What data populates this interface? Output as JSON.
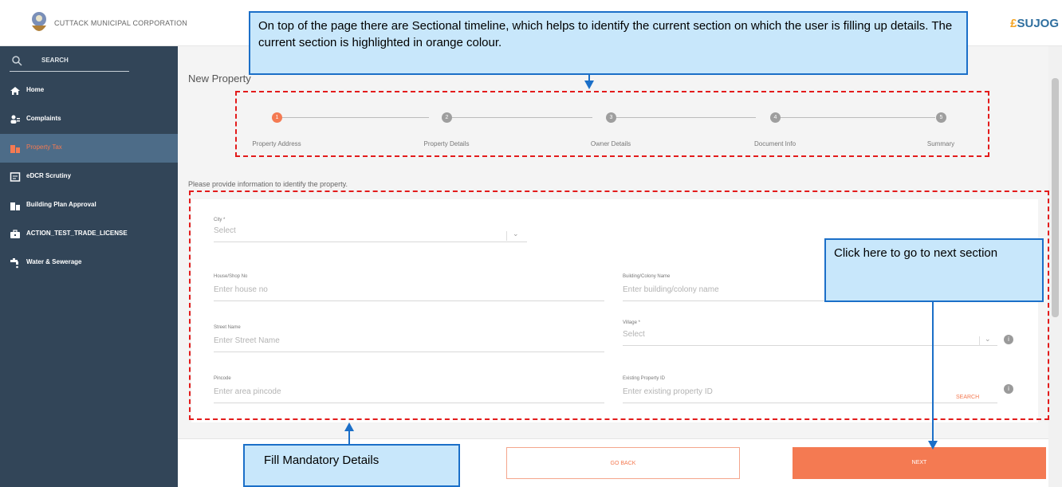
{
  "header": {
    "org_name": "CUTTACK MUNICIPAL CORPORATION",
    "brand_lead": "£",
    "brand_name": "SUJOG"
  },
  "sidebar": {
    "search_label": "SEARCH",
    "items": [
      {
        "label": "Home",
        "icon": "home-icon"
      },
      {
        "label": "Complaints",
        "icon": "people-icon"
      },
      {
        "label": "Property Tax",
        "icon": "building-icon",
        "active": true
      },
      {
        "label": "eDCR Scrutiny",
        "icon": "document-icon"
      },
      {
        "label": "Building Plan Approval",
        "icon": "building-icon"
      },
      {
        "label": "ACTION_TEST_TRADE_LICENSE",
        "icon": "briefcase-icon"
      },
      {
        "label": "Water & Sewerage",
        "icon": "water-tap-icon"
      }
    ]
  },
  "main": {
    "page_title": "New Property",
    "timeline": [
      {
        "label": "Property Address",
        "number": "1",
        "current": true
      },
      {
        "label": "Property Details",
        "number": "2"
      },
      {
        "label": "Owner Details",
        "number": "3"
      },
      {
        "label": "Document Info",
        "number": "4"
      },
      {
        "label": "Summary",
        "number": "5"
      }
    ],
    "helper_text": "Please provide information to identify the property.",
    "form": {
      "city": {
        "label": "City *",
        "placeholder": "Select"
      },
      "house_no": {
        "label": "House/Shop No",
        "placeholder": "Enter house no"
      },
      "building_name": {
        "label": "Building/Colony Name",
        "placeholder": "Enter building/colony name"
      },
      "street_name": {
        "label": "Street Name",
        "placeholder": "Enter Street Name"
      },
      "village": {
        "label": "Village *",
        "placeholder": "Select"
      },
      "pincode": {
        "label": "Pincode",
        "placeholder": "Enter area pincode"
      },
      "existing_id": {
        "label": "Existing Property ID",
        "placeholder": "Enter existing property ID",
        "search_label": "SEARCH"
      }
    },
    "buttons": {
      "back": "GO BACK",
      "next": "NEXT"
    }
  },
  "annotations": {
    "timeline_note": "On top of the page there are Sectional timeline, which helps to identify the current section on which the user is filling up details. The current section is highlighted in orange colour.",
    "next_note": "Click here to go to next section",
    "mandatory_note": "Fill Mandatory Details"
  },
  "colors": {
    "sidebar": "#324558",
    "accent": "#f47a52",
    "annotation_fill": "#c8e7fb",
    "annotation_border": "#1b6fc8",
    "dashed_border": "#e31b1b"
  }
}
